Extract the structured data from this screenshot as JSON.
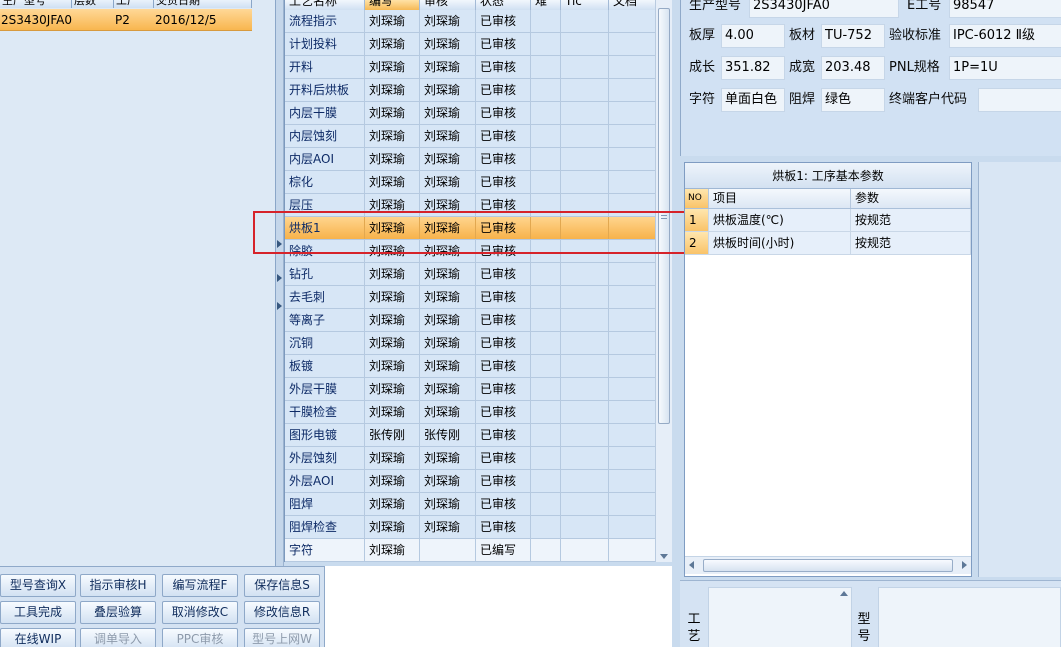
{
  "left_grid": {
    "columns": [
      "生产型号",
      "层数",
      "工厂",
      "交货日期"
    ],
    "row": {
      "model": "2S3430JFA0",
      "layers": "P2",
      "date": "2016/12/5"
    }
  },
  "process_grid": {
    "columns": [
      "工艺名称",
      "编写",
      "审核",
      "状态",
      "难",
      "Tic",
      "文档"
    ],
    "rows": [
      {
        "name": "流程指示",
        "writer": "刘琛瑜",
        "reviewer": "刘琛瑜",
        "status": "已审核"
      },
      {
        "name": "计划投料",
        "writer": "刘琛瑜",
        "reviewer": "刘琛瑜",
        "status": "已审核"
      },
      {
        "name": "开料",
        "writer": "刘琛瑜",
        "reviewer": "刘琛瑜",
        "status": "已审核"
      },
      {
        "name": "开料后烘板",
        "writer": "刘琛瑜",
        "reviewer": "刘琛瑜",
        "status": "已审核"
      },
      {
        "name": "内层干膜",
        "writer": "刘琛瑜",
        "reviewer": "刘琛瑜",
        "status": "已审核"
      },
      {
        "name": "内层蚀刻",
        "writer": "刘琛瑜",
        "reviewer": "刘琛瑜",
        "status": "已审核"
      },
      {
        "name": "内层AOI",
        "writer": "刘琛瑜",
        "reviewer": "刘琛瑜",
        "status": "已审核"
      },
      {
        "name": "棕化",
        "writer": "刘琛瑜",
        "reviewer": "刘琛瑜",
        "status": "已审核"
      },
      {
        "name": "层压",
        "writer": "刘琛瑜",
        "reviewer": "刘琛瑜",
        "status": "已审核"
      },
      {
        "name": "烘板1",
        "writer": "刘琛瑜",
        "reviewer": "刘琛瑜",
        "status": "已审核"
      },
      {
        "name": "除胶",
        "writer": "刘琛瑜",
        "reviewer": "刘琛瑜",
        "status": "已审核"
      },
      {
        "name": "钻孔",
        "writer": "刘琛瑜",
        "reviewer": "刘琛瑜",
        "status": "已审核"
      },
      {
        "name": "去毛刺",
        "writer": "刘琛瑜",
        "reviewer": "刘琛瑜",
        "status": "已审核"
      },
      {
        "name": "等离子",
        "writer": "刘琛瑜",
        "reviewer": "刘琛瑜",
        "status": "已审核"
      },
      {
        "name": "沉铜",
        "writer": "刘琛瑜",
        "reviewer": "刘琛瑜",
        "status": "已审核"
      },
      {
        "name": "板镀",
        "writer": "刘琛瑜",
        "reviewer": "刘琛瑜",
        "status": "已审核"
      },
      {
        "name": "外层干膜",
        "writer": "刘琛瑜",
        "reviewer": "刘琛瑜",
        "status": "已审核"
      },
      {
        "name": "干膜检查",
        "writer": "刘琛瑜",
        "reviewer": "刘琛瑜",
        "status": "已审核"
      },
      {
        "name": "图形电镀",
        "writer": "张传刚",
        "reviewer": "张传刚",
        "status": "已审核"
      },
      {
        "name": "外层蚀刻",
        "writer": "刘琛瑜",
        "reviewer": "刘琛瑜",
        "status": "已审核"
      },
      {
        "name": "外层AOI",
        "writer": "刘琛瑜",
        "reviewer": "刘琛瑜",
        "status": "已审核"
      },
      {
        "name": "阻焊",
        "writer": "刘琛瑜",
        "reviewer": "刘琛瑜",
        "status": "已审核"
      },
      {
        "name": "阻焊检查",
        "writer": "刘琛瑜",
        "reviewer": "刘琛瑜",
        "status": "已审核"
      },
      {
        "name": "字符",
        "writer": "刘琛瑜",
        "reviewer": "",
        "status": "已编写"
      }
    ]
  },
  "info": {
    "model_label": "生产型号",
    "model_value": "2S3430JFA0",
    "eno_label": "E工号",
    "eno_value": "98547",
    "thickness_label": "板厚",
    "thickness_value": "4.00",
    "material_label": "板材",
    "material_value": "TU-752",
    "standard_label": "验收标准",
    "standard_value": "IPC-6012 Ⅱ级",
    "length_label": "成长",
    "length_value": "351.82",
    "width_label": "成宽",
    "width_value": "203.48",
    "pnl_label": "PNL规格",
    "pnl_value": "1P=1U",
    "legend_label": "字符",
    "legend_value": "单面白色",
    "mask_label": "阻焊",
    "mask_value": "绿色",
    "customer_label": "终端客户代码",
    "customer_value": ""
  },
  "params": {
    "title": "烘板1: 工序基本参数",
    "headers": {
      "no": "NO",
      "item": "项目",
      "value": "参数"
    },
    "rows": [
      {
        "no": "1",
        "item": "烘板温度(℃)",
        "value": "按规范"
      },
      {
        "no": "2",
        "item": "烘板时间(小时)",
        "value": "按规范"
      }
    ]
  },
  "bottom_labels": {
    "craft": "工艺",
    "model": "型号"
  },
  "buttons": {
    "model_query": "型号查询X",
    "instr_review": "指示审核H",
    "edit_flow": "编写流程F",
    "save_info": "保存信息S",
    "tool_done": "工具完成",
    "stack_check": "叠层验算",
    "cancel_edit": "取消修改C",
    "modify_info": "修改信息R",
    "online_wip": "在线WIP",
    "order_import": "调单导入",
    "ppc_review": "PPC审核",
    "model_online": "型号上网W"
  }
}
